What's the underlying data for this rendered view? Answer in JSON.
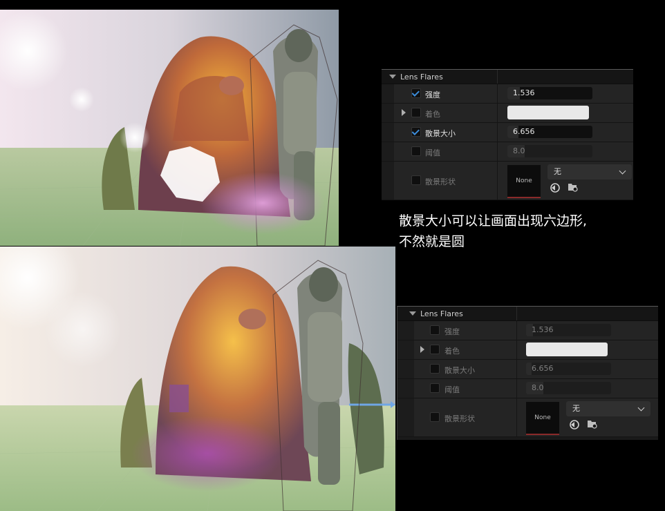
{
  "caption": {
    "line1": "散景大小可以让画面出现六边形,",
    "line2": "不然就是圆"
  },
  "panels": [
    {
      "section_title": "Lens Flares",
      "rows": [
        {
          "label": "强度",
          "enabled": true,
          "value": "1.536",
          "fill": 0.15
        },
        {
          "label": "着色",
          "enabled": false,
          "swatch_color": "#e8e8e8",
          "expandable": true
        },
        {
          "label": "散景大小",
          "enabled": true,
          "value": "6.656",
          "fill": 0.13
        },
        {
          "label": "阈值",
          "enabled": false,
          "value": "8.0",
          "fill": 0.2
        },
        {
          "label": "散景形状",
          "enabled": false,
          "texture": "None",
          "combo_value": "无"
        }
      ]
    },
    {
      "section_title": "Lens Flares",
      "rows": [
        {
          "label": "强度",
          "enabled": false,
          "value": "1.536",
          "fill": 0.08
        },
        {
          "label": "着色",
          "enabled": false,
          "swatch_color": "#e8e8e8",
          "expandable": true
        },
        {
          "label": "散景大小",
          "enabled": false,
          "value": "6.656",
          "fill": 0.06
        },
        {
          "label": "阈值",
          "enabled": false,
          "value": "8.0",
          "fill": 0.2
        },
        {
          "label": "散景形状",
          "enabled": false,
          "texture": "None",
          "combo_value": "无"
        }
      ]
    }
  ],
  "colors": {
    "checkbox_accent": "#3c8bd8",
    "panel_bg": "#242424"
  },
  "icons": [
    "chevron-down-icon",
    "reset-arrow-icon",
    "browse-folder-icon"
  ]
}
